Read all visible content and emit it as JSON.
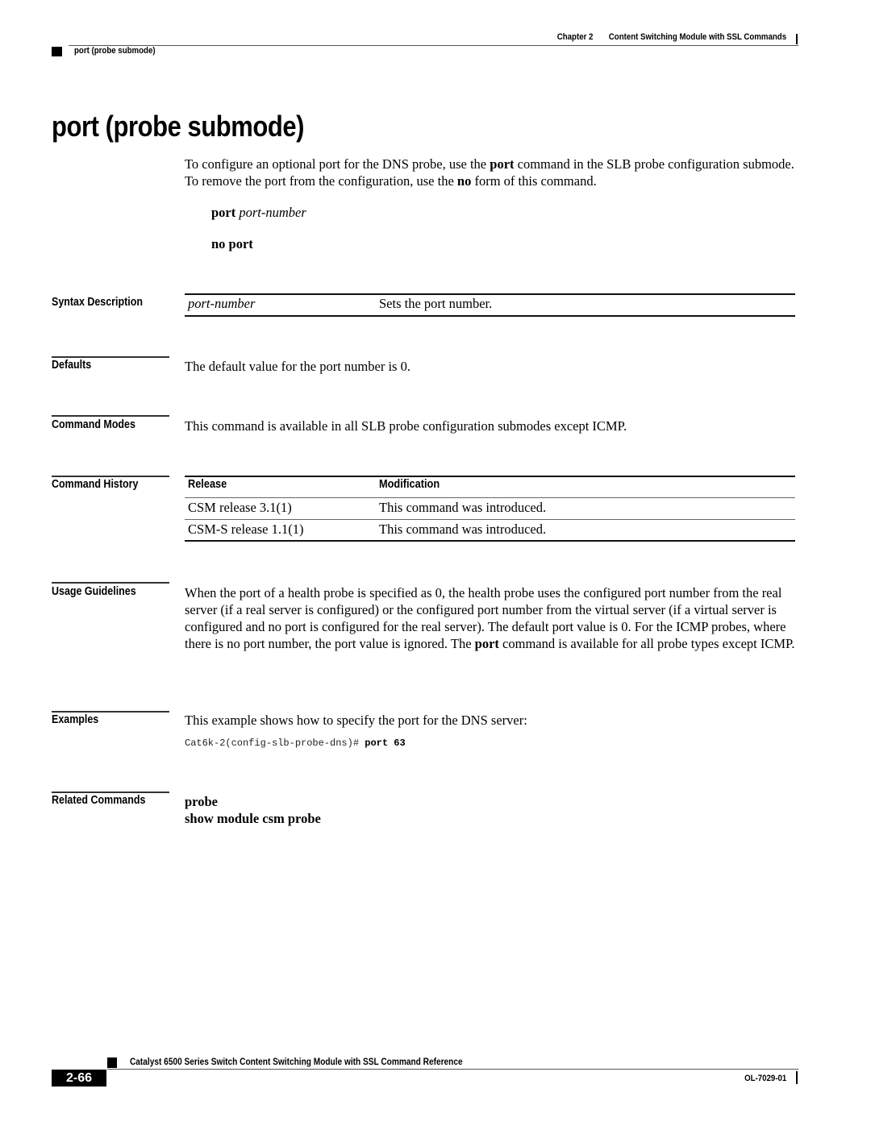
{
  "header": {
    "chapter_label": "Chapter 2",
    "chapter_title": "Content Switching Module with SSL Commands",
    "section_running_head": "port (probe submode)"
  },
  "title": "port (probe submode)",
  "intro": {
    "part1": "To configure an optional port for the DNS probe, use the ",
    "bold1": "port",
    "part2": " command in the SLB probe configuration submode. To remove the port from the configuration, use the ",
    "bold2": "no",
    "part3": " form of this command."
  },
  "syntax": {
    "line1_cmd": "port",
    "line1_arg": "port-number",
    "line2_cmd": "no port"
  },
  "sections": {
    "syntax_description": {
      "label": "Syntax Description",
      "rows": [
        {
          "param": "port-number",
          "description": "Sets the port number."
        }
      ]
    },
    "defaults": {
      "label": "Defaults",
      "text": "The default value for the port number is 0."
    },
    "command_modes": {
      "label": "Command Modes",
      "text": "This command is available in all SLB probe configuration submodes except ICMP."
    },
    "command_history": {
      "label": "Command History",
      "headers": [
        "Release",
        "Modification"
      ],
      "rows": [
        {
          "release": "CSM release 3.1(1)",
          "modification": "This command was introduced."
        },
        {
          "release": "CSM-S release 1.1(1)",
          "modification": "This command was introduced."
        }
      ]
    },
    "usage_guidelines": {
      "label": "Usage Guidelines",
      "part1": "When the port of a health probe is specified as 0, the health probe uses the configured port number from the real server (if a real server is configured) or the configured port number from the virtual server (if a virtual server is configured and no port is configured for the real server). The default port value is 0. For the ICMP probes, where there is no port number, the port value is ignored. The ",
      "bold": "port",
      "part2": " command is available for all probe types except ICMP."
    },
    "examples": {
      "label": "Examples",
      "text": "This example shows how to specify the port for the DNS server:",
      "code_prompt": "Cat6k-2(config-slb-probe-dns)# ",
      "code_command": "port 63"
    },
    "related_commands": {
      "label": "Related Commands",
      "items": [
        "probe",
        "show module csm probe"
      ]
    }
  },
  "footer": {
    "book_title": "Catalyst 6500 Series Switch Content Switching Module with SSL Command Reference",
    "page_number": "2-66",
    "doc_number": "OL-7029-01"
  }
}
